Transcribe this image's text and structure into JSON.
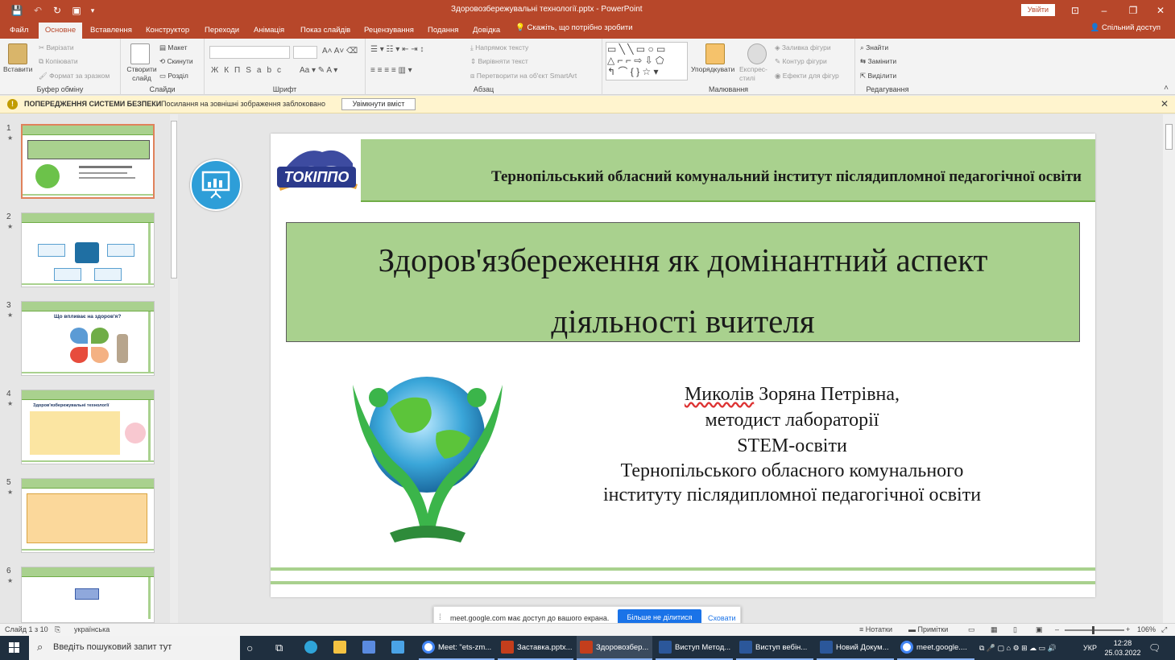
{
  "window": {
    "title": "Здоровозбережувальні технології.pptx  -  PowerPoint",
    "signin": "Увійти"
  },
  "tabs": [
    "Файл",
    "Основне",
    "Вставлення",
    "Конструктор",
    "Переходи",
    "Анімація",
    "Показ слайдів",
    "Рецензування",
    "Подання",
    "Довідка"
  ],
  "tell_me": "Скажіть, що потрібно зробити",
  "share": "Спільний доступ",
  "ribbon": {
    "paste": "Вставити",
    "cut": "Вирізати",
    "copy": "Копіювати",
    "format_painter": "Формат за зразком",
    "clipboard": "Буфер обміну",
    "new_slide": "Створити слайд",
    "layout": "Макет",
    "reset": "Скинути",
    "section": "Розділ",
    "slides": "Слайди",
    "font": "Шрифт",
    "text_direction": "Напрямок тексту",
    "align_text": "Вирівняти текст",
    "smartart": "Перетворити на об'єкт SmartArt",
    "paragraph": "Абзац",
    "arrange": "Упорядкувати",
    "quick_styles": "Експрес-стилі",
    "shape_fill": "Заливка фігури",
    "shape_outline": "Контур фігури",
    "shape_effects": "Ефекти для фігур",
    "drawing": "Малювання",
    "find": "Знайти",
    "replace": "Замінити",
    "select": "Виділити",
    "editing": "Редагування"
  },
  "security": {
    "title": "ПОПЕРЕДЖЕННЯ СИСТЕМИ БЕЗПЕКИ",
    "message": "Посилання на зовнішні зображення заблоковано",
    "button": "Увімкнути вміст"
  },
  "thumbnails": [
    {
      "num": "1",
      "star": "★"
    },
    {
      "num": "2",
      "star": "★"
    },
    {
      "num": "3",
      "star": "★",
      "title": "Що впливає на здоров'я?"
    },
    {
      "num": "4",
      "star": "★",
      "title": "Здоров'язбережувальні технології"
    },
    {
      "num": "5",
      "star": "★"
    },
    {
      "num": "6",
      "star": "★"
    }
  ],
  "slide": {
    "org": "Тернопільський обласний комунальний інститут післядипломної педагогічної освіти",
    "logo_text": "ТОКІППО",
    "title_line1": "Здоров'язбереження як домінантний аспект",
    "title_line2": "діяльності вчителя",
    "author_name": "Миколів",
    "author_rest": " Зоряна Петрівна,",
    "author_line2": "методист  лабораторії",
    "author_line3": "STEM-освіти",
    "author_line4": "Тернопільського обласного комунального",
    "author_line5": "інституту післядипломної педагогічної освіти"
  },
  "share_banner": {
    "message": "meet.google.com має доступ до вашого екрана.",
    "stop": "Більше не ділитися",
    "hide": "Сховати"
  },
  "status": {
    "slide_counter": "Слайд 1 з 10",
    "language": "українська",
    "notes": "Нотатки",
    "comments": "Примітки",
    "zoom": "106%"
  },
  "taskbar": {
    "search_placeholder": "Введіть пошуковий запит тут",
    "items": [
      {
        "label": "Meet: \"ets-zm...",
        "color": "#4285f4"
      },
      {
        "label": "Заставка.pptx...",
        "color": "#c43e1c"
      },
      {
        "label": "Здоровозбер...",
        "color": "#c43e1c"
      },
      {
        "label": "Виступ Метод...",
        "color": "#2b579a"
      },
      {
        "label": "Виступ вебін...",
        "color": "#2b579a"
      },
      {
        "label": "Новий Докум...",
        "color": "#2b579a"
      },
      {
        "label": "meet.google....",
        "color": "#4285f4"
      }
    ],
    "lang": "УКР",
    "time": "12:28",
    "date": "25.03.2022"
  }
}
